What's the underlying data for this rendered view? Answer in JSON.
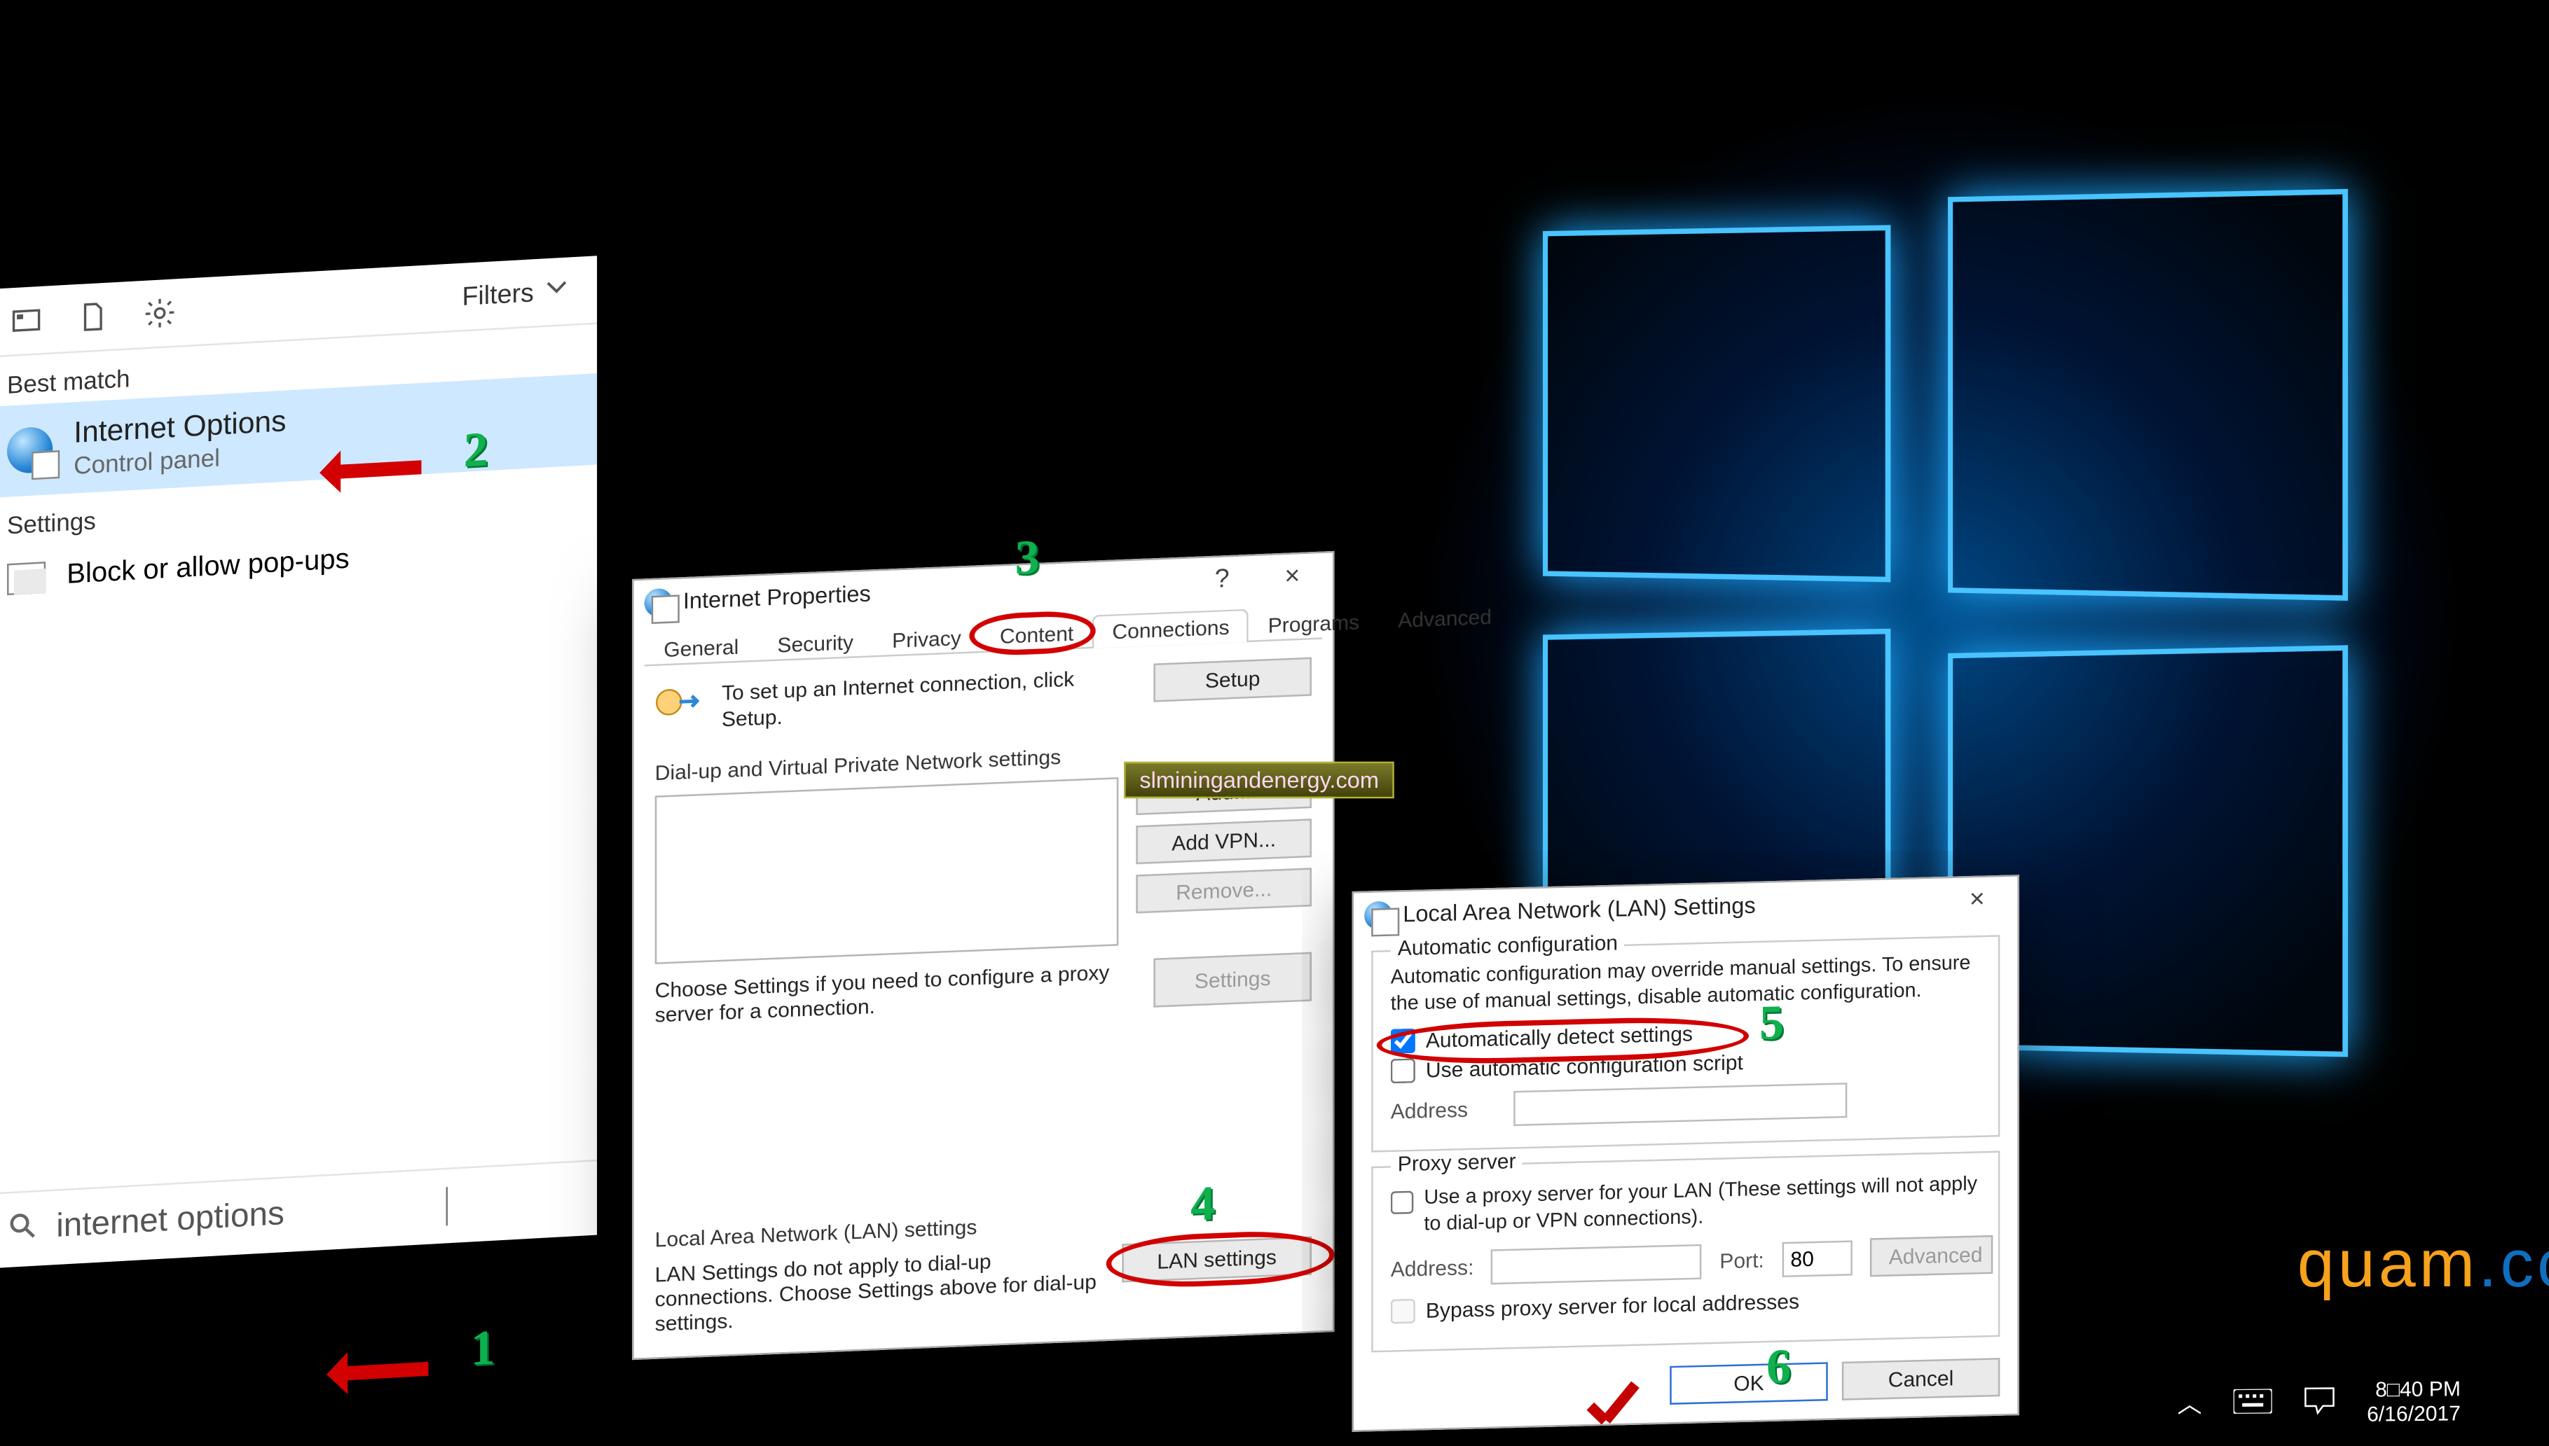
{
  "annotations": {
    "1": "1",
    "2": "2",
    "3": "3",
    "4": "4",
    "5": "5",
    "6": "6"
  },
  "watermark": {
    "a": "quam",
    "b": ".cc"
  },
  "pink_site": "slminingandenergy.com",
  "start": {
    "filters": "Filters",
    "best_match_label": "Best match",
    "best_match_item": {
      "title": "Internet Options",
      "subtitle": "Control panel"
    },
    "settings_label": "Settings",
    "settings_item": "Block or allow pop-ups",
    "search_value": "internet options"
  },
  "iprops": {
    "title": "Internet Properties",
    "help": "?",
    "close": "×",
    "tabs": {
      "general": "General",
      "security": "Security",
      "privacy": "Privacy",
      "content": "Content",
      "connections": "Connections",
      "programs": "Programs",
      "advanced": "Advanced"
    },
    "setup_desc": "To set up an Internet connection, click Setup.",
    "setup_btn": "Setup",
    "dial_group": "Dial-up and Virtual Private Network settings",
    "add": "Add...",
    "addvpn": "Add VPN...",
    "remove": "Remove...",
    "settings_btn": "Settings",
    "choose_desc": "Choose Settings if you need to configure a proxy server for a connection.",
    "lan_group": "Local Area Network (LAN) settings",
    "lan_desc": "LAN Settings do not apply to dial-up connections. Choose Settings above for dial-up settings.",
    "lan_btn": "LAN settings"
  },
  "lan": {
    "title": "Local Area Network (LAN) Settings",
    "close": "×",
    "auto_group": "Automatic configuration",
    "auto_note": "Automatic configuration may override manual settings.  To ensure the use of manual settings, disable automatic configuration.",
    "auto_detect": "Automatically detect settings",
    "use_script": "Use automatic configuration script",
    "address_label": "Address",
    "proxy_group": "Proxy server",
    "proxy_note": "Use a proxy server for your LAN (These settings will not apply to dial-up or VPN connections).",
    "address2": "Address:",
    "port": "Port:",
    "port_value": "80",
    "advanced": "Advanced",
    "bypass": "Bypass proxy server for local addresses",
    "ok": "OK",
    "cancel": "Cancel"
  },
  "tray": {
    "time": "8□40 PM",
    "date": "6/16/2017"
  }
}
